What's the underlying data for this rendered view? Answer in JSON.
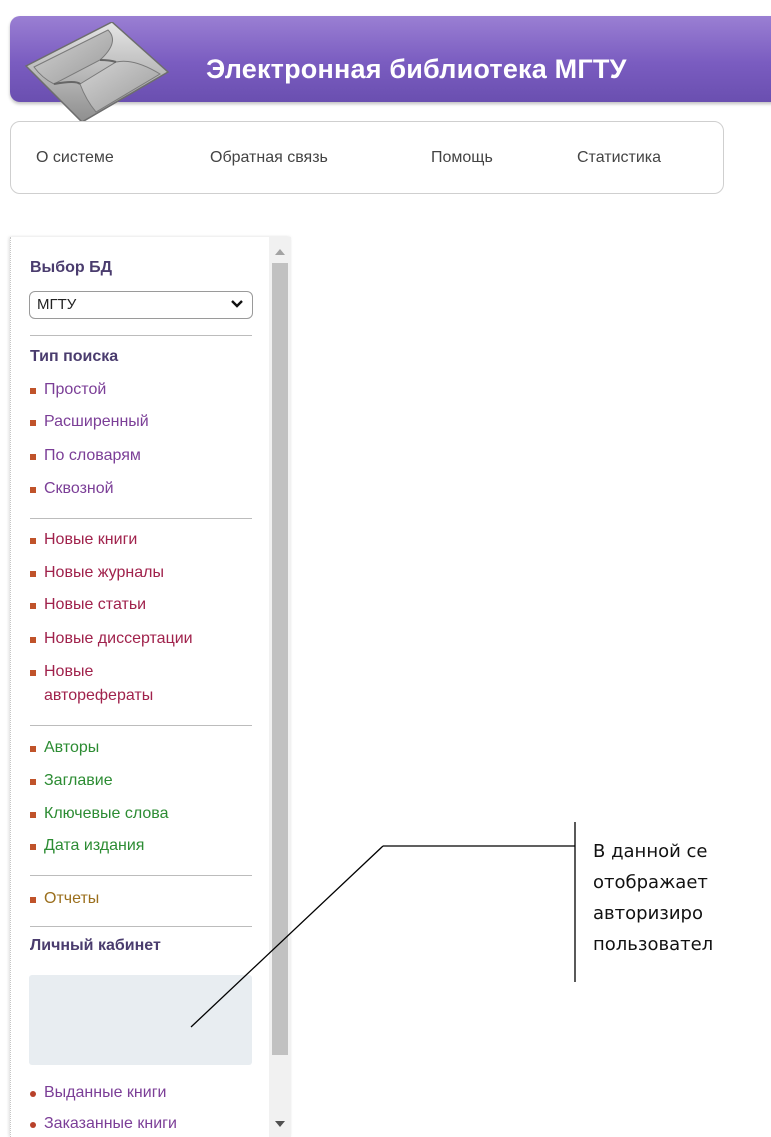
{
  "header": {
    "title": "Электронная библиотека МГТУ",
    "logo_icon": "open-book-icon"
  },
  "topmenu": {
    "items": [
      "О системе",
      "Обратная связь",
      "Помощь",
      "Статистика"
    ]
  },
  "sidebar": {
    "db_title": "Выбор БД",
    "db_select": {
      "value": "МГТУ"
    },
    "search_title": "Тип поиска",
    "search_types": [
      "Простой",
      "Расширенный",
      "По словарям",
      "Сквозной"
    ],
    "new_items": [
      "Новые книги",
      "Новые журналы",
      "Новые статьи",
      "Новые диссертации",
      "Новые",
      "авторефераты"
    ],
    "browse_items": [
      "Авторы",
      "Заглавие",
      "Ключевые слова",
      "Дата издания"
    ],
    "reports": [
      "Отчеты"
    ],
    "cabinet_title": "Личный кабинет",
    "cabinet_items": [
      "Выданные книги",
      "Заказанные книги"
    ]
  },
  "annotation": {
    "lines": [
      "В данной се",
      "отображает",
      "авторизиро",
      "пользовател"
    ]
  },
  "colors": {
    "header_purple": "#7a5cc0",
    "link_purple": "#7b3e97",
    "link_red": "#a0224c",
    "link_green": "#2c8c33",
    "link_olive": "#9b6f1d",
    "bullet": "#c0532a"
  }
}
